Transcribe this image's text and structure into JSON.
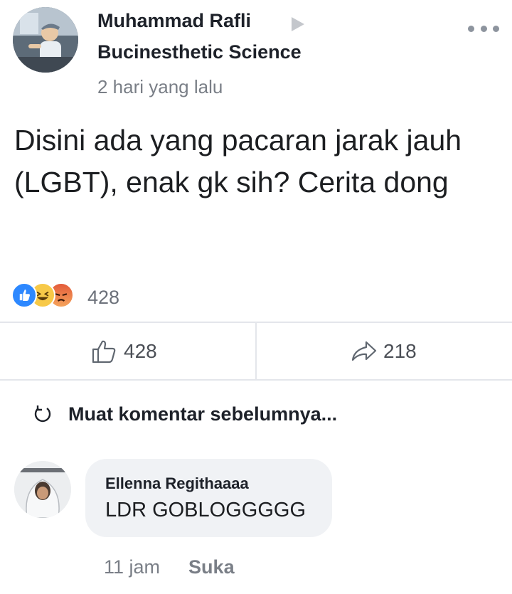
{
  "post": {
    "author": "Muhammad Rafli",
    "group": "Bucinesthetic Science",
    "time": "2 hari yang lalu",
    "body": "Disini ada yang pacaran jarak jauh (LGBT), enak gk sih? Cerita dong",
    "reactions_count": "428",
    "reaction_types": [
      "like",
      "haha",
      "angry"
    ]
  },
  "actions": {
    "like_count": "428",
    "share_count": "218"
  },
  "comments": {
    "load_previous": "Muat komentar sebelumnya...",
    "items": [
      {
        "author": "Ellenna Regithaaaa",
        "text": "LDR GOBLOGGGGG",
        "time": "11 jam",
        "like_label": "Suka"
      }
    ]
  },
  "icons": {
    "more": "more-dots-icon",
    "caret": "caret-right-icon",
    "like": "thumbs-up-icon",
    "share": "share-arrow-icon",
    "refresh": "refresh-icon"
  },
  "colors": {
    "like_blue": "#2d88ff",
    "haha_yellow": "#f7c948",
    "angry_red": "#e35b3a",
    "bubble_bg": "#f0f2f5",
    "muted_text": "#7a7f87"
  }
}
